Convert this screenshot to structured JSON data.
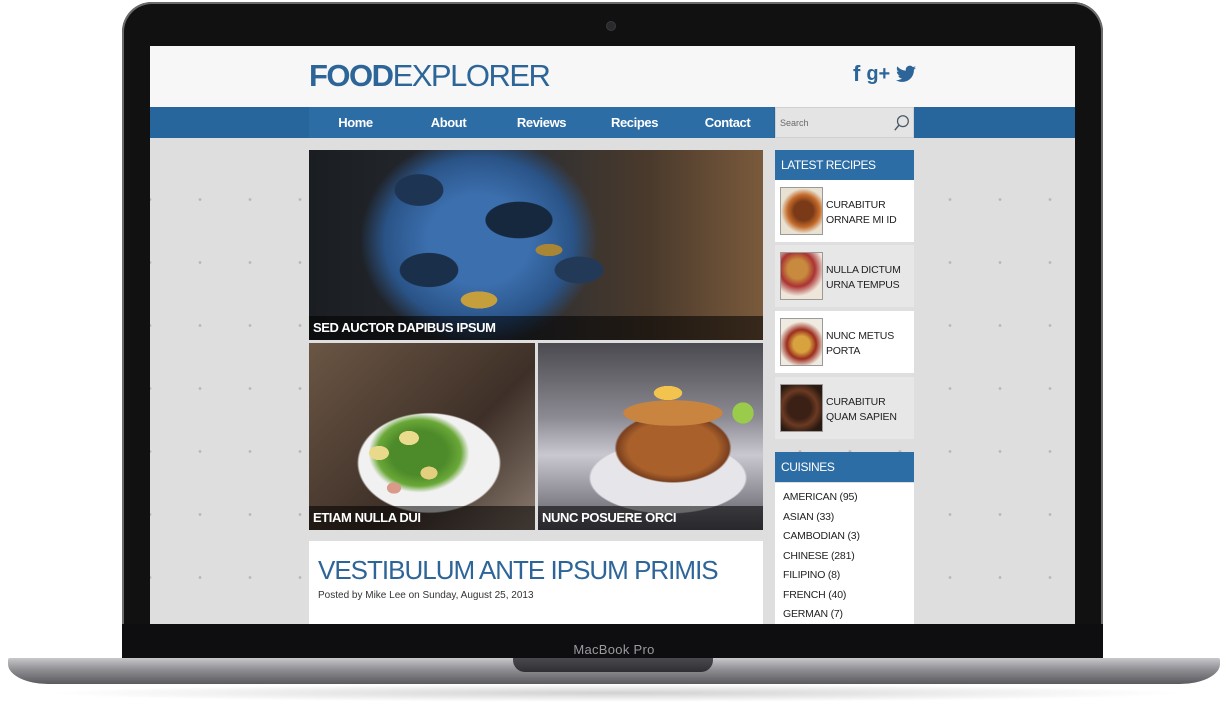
{
  "device": {
    "label": "MacBook Pro"
  },
  "site": {
    "logo_bold": "FOOD",
    "logo_thin": "EXPLORER",
    "social": {
      "facebook": "f",
      "googleplus": "g+"
    },
    "nav": [
      "Home",
      "About",
      "Reviews",
      "Recipes",
      "Contact"
    ],
    "search": {
      "placeholder": "Search",
      "icon": "search-icon"
    }
  },
  "featured": {
    "main_caption": "SED AUCTOR DAPIBUS IPSUM",
    "left_caption": "ETIAM NULLA DUI",
    "right_caption": "NUNC POSUERE ORCI"
  },
  "article": {
    "title": "VESTIBULUM ANTE IPSUM PRIMIS",
    "meta": "Posted by Mike Lee on Sunday, August 25, 2013"
  },
  "sidebar": {
    "latest_title": "LATEST RECIPES",
    "recipes": [
      "CURABITUR ORNARE MI ID",
      "NULLA DICTUM URNA TEMPUS",
      "NUNC METUS PORTA",
      "CURABITUR QUAM SAPIEN"
    ],
    "cuisines_title": "CUISINES",
    "cuisines": [
      "AMERICAN (95)",
      "ASIAN (33)",
      "CAMBODIAN (3)",
      "CHINESE (281)",
      "FILIPINO (8)",
      "FRENCH (40)",
      "GERMAN (7)"
    ]
  },
  "colors": {
    "brand_blue": "#2d6da6",
    "nav_bar": "#27659d",
    "logo": "#2d6599"
  }
}
